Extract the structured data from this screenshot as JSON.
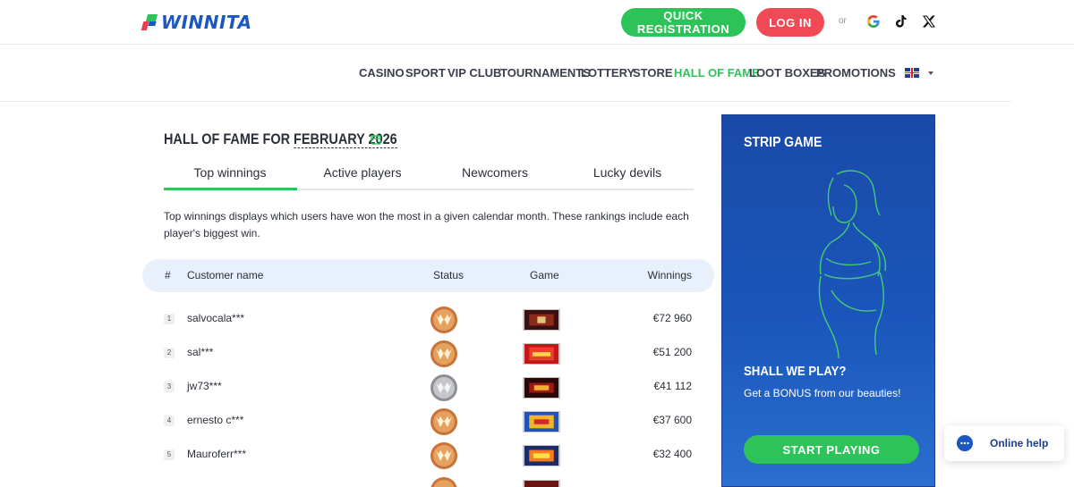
{
  "header": {
    "logo_text": "WINNITA",
    "register_label": "QUICK REGISTRATION",
    "login_label": "LOG IN",
    "or_label": "or",
    "social": [
      "google-icon",
      "tiktok-icon",
      "x-icon"
    ]
  },
  "nav": {
    "items": [
      {
        "label": "CASINO",
        "active": false
      },
      {
        "label": "SPORT",
        "active": false
      },
      {
        "label": "VIP CLUB",
        "active": false
      },
      {
        "label": "TOURNAMENTS",
        "active": false
      },
      {
        "label": "LOTTERY",
        "active": false
      },
      {
        "label": "STORE",
        "active": false
      },
      {
        "label": "HALL OF FAME",
        "active": true
      },
      {
        "label": "LOOT BOXES",
        "active": false
      },
      {
        "label": "PROMOTIONS",
        "active": false
      }
    ],
    "language_flag": "uk-flag-icon"
  },
  "hof": {
    "title_prefix": "HALL OF FAME FOR",
    "month": "FEBRUARY 2026",
    "tabs": [
      {
        "label": "Top winnings",
        "active": true
      },
      {
        "label": "Active players",
        "active": false
      },
      {
        "label": "Newcomers",
        "active": false
      },
      {
        "label": "Lucky devils",
        "active": false
      }
    ],
    "description": "Top winnings displays which users have won the most in a given calendar month. These rankings include each player's biggest win.",
    "table": {
      "headers": {
        "rank": "#",
        "name": "Customer name",
        "status": "Status",
        "game": "Game",
        "winnings": "Winnings"
      },
      "rows": [
        {
          "rank": "1",
          "name": "salvocala***",
          "status": "bronze",
          "winnings": "€72 960"
        },
        {
          "rank": "2",
          "name": "sal***",
          "status": "bronze",
          "winnings": "€51 200"
        },
        {
          "rank": "3",
          "name": "jw73***",
          "status": "silver",
          "winnings": "€41 112"
        },
        {
          "rank": "4",
          "name": "ernesto c***",
          "status": "bronze",
          "winnings": "€37 600"
        },
        {
          "rank": "5",
          "name": "Mauroferr***",
          "status": "bronze",
          "winnings": "€32 400"
        }
      ]
    }
  },
  "promo": {
    "title": "STRIP GAME",
    "question": "SHALL WE PLAY?",
    "subtitle": "Get a BONUS from our beauties!",
    "button_label": "START PLAYING"
  },
  "help": {
    "label": "Online help"
  },
  "colors": {
    "brand_green": "#2ec359",
    "brand_red": "#ef4a55",
    "brand_blue": "#1a57c2"
  }
}
